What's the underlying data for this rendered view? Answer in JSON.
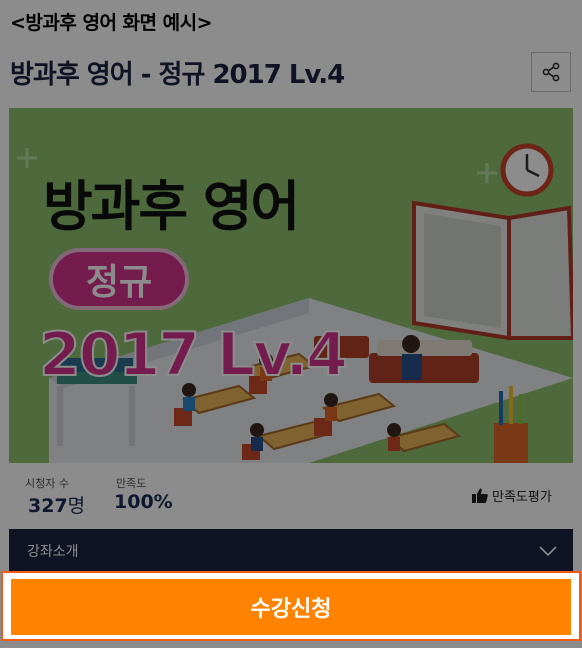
{
  "caption": "<방과후 영어 화면 예시>",
  "course": {
    "title": "방과후 영어 - 정규 2017 Lv.4"
  },
  "banner": {
    "title": "방과후 영어",
    "pill": "정규",
    "level": "2017 Lv.4"
  },
  "stats": {
    "viewers_label": "시청자 수",
    "viewers_value": "327",
    "viewers_unit": "명",
    "satisfaction_label": "만족도",
    "satisfaction_value": "100%",
    "rate_label": "만족도평가"
  },
  "accordion": {
    "label": "강좌소개"
  },
  "cta": {
    "label": "수강신청"
  },
  "colors": {
    "cta": "#ff8200",
    "cta_border": "#f05a1a",
    "navy": "#1d2340",
    "banner_bg": "#8ec170",
    "accent_pink": "#d4338c"
  },
  "icons": [
    "share-icon",
    "thumbs-up-icon",
    "chevron-down-icon",
    "clock-icon"
  ]
}
